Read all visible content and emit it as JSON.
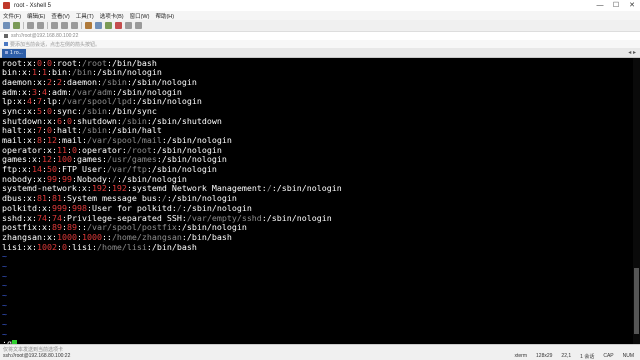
{
  "window": {
    "title": "root - Xshell 5",
    "controls": [
      "—",
      "☐",
      "✕"
    ]
  },
  "menu": [
    "文件(F)",
    "编辑(E)",
    "查看(V)",
    "工具(T)",
    "选项卡(B)",
    "窗口(W)",
    "帮助(H)"
  ],
  "address": {
    "text": "ssh://root@192.168.80.100:22"
  },
  "session_hint": {
    "text": "要添加当前会话，点击左侧的箭头按钮。"
  },
  "tabs": [
    {
      "label": "1 ro..."
    }
  ],
  "terminal": {
    "lines": [
      [
        {
          "t": "root",
          "c": "w"
        },
        {
          "t": ":x:",
          "c": "w"
        },
        {
          "t": "0",
          "c": "r"
        },
        {
          "t": ":",
          "c": "w"
        },
        {
          "t": "0",
          "c": "r"
        },
        {
          "t": ":root:",
          "c": "w"
        },
        {
          "t": "/root",
          "c": "d"
        },
        {
          "t": ":/bin/bash",
          "c": "w"
        }
      ],
      [
        {
          "t": "bin",
          "c": "w"
        },
        {
          "t": ":x:",
          "c": "w"
        },
        {
          "t": "1",
          "c": "r"
        },
        {
          "t": ":",
          "c": "w"
        },
        {
          "t": "1",
          "c": "r"
        },
        {
          "t": ":bin:",
          "c": "w"
        },
        {
          "t": "/bin",
          "c": "d"
        },
        {
          "t": ":/sbin/nologin",
          "c": "w"
        }
      ],
      [
        {
          "t": "daemon",
          "c": "w"
        },
        {
          "t": ":x:",
          "c": "w"
        },
        {
          "t": "2",
          "c": "r"
        },
        {
          "t": ":",
          "c": "w"
        },
        {
          "t": "2",
          "c": "r"
        },
        {
          "t": ":daemon:",
          "c": "w"
        },
        {
          "t": "/sbin",
          "c": "d"
        },
        {
          "t": ":/sbin/nologin",
          "c": "w"
        }
      ],
      [
        {
          "t": "adm",
          "c": "w"
        },
        {
          "t": ":x:",
          "c": "w"
        },
        {
          "t": "3",
          "c": "r"
        },
        {
          "t": ":",
          "c": "w"
        },
        {
          "t": "4",
          "c": "r"
        },
        {
          "t": ":adm:",
          "c": "w"
        },
        {
          "t": "/var/adm",
          "c": "d"
        },
        {
          "t": ":/sbin/nologin",
          "c": "w"
        }
      ],
      [
        {
          "t": "lp",
          "c": "w"
        },
        {
          "t": ":x:",
          "c": "w"
        },
        {
          "t": "4",
          "c": "r"
        },
        {
          "t": ":",
          "c": "w"
        },
        {
          "t": "7",
          "c": "r"
        },
        {
          "t": ":lp:",
          "c": "w"
        },
        {
          "t": "/var/spool/lpd",
          "c": "d"
        },
        {
          "t": ":/sbin/nologin",
          "c": "w"
        }
      ],
      [
        {
          "t": "sync",
          "c": "w"
        },
        {
          "t": ":x:",
          "c": "w"
        },
        {
          "t": "5",
          "c": "r"
        },
        {
          "t": ":",
          "c": "w"
        },
        {
          "t": "0",
          "c": "r"
        },
        {
          "t": ":sync:",
          "c": "w"
        },
        {
          "t": "/sbin",
          "c": "d"
        },
        {
          "t": ":/bin/sync",
          "c": "w"
        }
      ],
      [
        {
          "t": "shutdown",
          "c": "w"
        },
        {
          "t": ":x:",
          "c": "w"
        },
        {
          "t": "6",
          "c": "r"
        },
        {
          "t": ":",
          "c": "w"
        },
        {
          "t": "0",
          "c": "r"
        },
        {
          "t": ":shutdown:",
          "c": "w"
        },
        {
          "t": "/sbin",
          "c": "d"
        },
        {
          "t": ":/sbin/shutdown",
          "c": "w"
        }
      ],
      [
        {
          "t": "halt",
          "c": "w"
        },
        {
          "t": ":x:",
          "c": "w"
        },
        {
          "t": "7",
          "c": "r"
        },
        {
          "t": ":",
          "c": "w"
        },
        {
          "t": "0",
          "c": "r"
        },
        {
          "t": ":halt:",
          "c": "w"
        },
        {
          "t": "/sbin",
          "c": "d"
        },
        {
          "t": ":/sbin/halt",
          "c": "w"
        }
      ],
      [
        {
          "t": "mail",
          "c": "w"
        },
        {
          "t": ":x:",
          "c": "w"
        },
        {
          "t": "8",
          "c": "r"
        },
        {
          "t": ":",
          "c": "w"
        },
        {
          "t": "12",
          "c": "r"
        },
        {
          "t": ":mail:",
          "c": "w"
        },
        {
          "t": "/var/spool/mail",
          "c": "d"
        },
        {
          "t": ":/sbin/nologin",
          "c": "w"
        }
      ],
      [
        {
          "t": "operator",
          "c": "w"
        },
        {
          "t": ":x:",
          "c": "w"
        },
        {
          "t": "11",
          "c": "r"
        },
        {
          "t": ":",
          "c": "w"
        },
        {
          "t": "0",
          "c": "r"
        },
        {
          "t": ":operator:",
          "c": "w"
        },
        {
          "t": "/root",
          "c": "d"
        },
        {
          "t": ":/sbin/nologin",
          "c": "w"
        }
      ],
      [
        {
          "t": "games",
          "c": "w"
        },
        {
          "t": ":x:",
          "c": "w"
        },
        {
          "t": "12",
          "c": "r"
        },
        {
          "t": ":",
          "c": "w"
        },
        {
          "t": "100",
          "c": "r"
        },
        {
          "t": ":games:",
          "c": "w"
        },
        {
          "t": "/usr/games",
          "c": "d"
        },
        {
          "t": ":/sbin/nologin",
          "c": "w"
        }
      ],
      [
        {
          "t": "ftp",
          "c": "w"
        },
        {
          "t": ":x:",
          "c": "w"
        },
        {
          "t": "14",
          "c": "r"
        },
        {
          "t": ":",
          "c": "w"
        },
        {
          "t": "50",
          "c": "r"
        },
        {
          "t": ":FTP User:",
          "c": "w"
        },
        {
          "t": "/var/ftp",
          "c": "d"
        },
        {
          "t": ":/sbin/nologin",
          "c": "w"
        }
      ],
      [
        {
          "t": "nobody",
          "c": "w"
        },
        {
          "t": ":x:",
          "c": "w"
        },
        {
          "t": "99",
          "c": "r"
        },
        {
          "t": ":",
          "c": "w"
        },
        {
          "t": "99",
          "c": "r"
        },
        {
          "t": ":Nobody:",
          "c": "w"
        },
        {
          "t": "/",
          "c": "d"
        },
        {
          "t": ":/sbin/nologin",
          "c": "w"
        }
      ],
      [
        {
          "t": "systemd-network",
          "c": "w"
        },
        {
          "t": ":x:",
          "c": "w"
        },
        {
          "t": "192",
          "c": "r"
        },
        {
          "t": ":",
          "c": "w"
        },
        {
          "t": "192",
          "c": "r"
        },
        {
          "t": ":systemd Network Management:",
          "c": "w"
        },
        {
          "t": "/",
          "c": "d"
        },
        {
          "t": ":/sbin/nologin",
          "c": "w"
        }
      ],
      [
        {
          "t": "dbus",
          "c": "w"
        },
        {
          "t": ":x:",
          "c": "w"
        },
        {
          "t": "81",
          "c": "r"
        },
        {
          "t": ":",
          "c": "w"
        },
        {
          "t": "81",
          "c": "r"
        },
        {
          "t": ":System message bus:",
          "c": "w"
        },
        {
          "t": "/",
          "c": "d"
        },
        {
          "t": ":/sbin/nologin",
          "c": "w"
        }
      ],
      [
        {
          "t": "polkitd",
          "c": "w"
        },
        {
          "t": ":x:",
          "c": "w"
        },
        {
          "t": "999",
          "c": "r"
        },
        {
          "t": ":",
          "c": "w"
        },
        {
          "t": "998",
          "c": "r"
        },
        {
          "t": ":User for polkitd:",
          "c": "w"
        },
        {
          "t": "/",
          "c": "d"
        },
        {
          "t": ":/sbin/nologin",
          "c": "w"
        }
      ],
      [
        {
          "t": "sshd",
          "c": "w"
        },
        {
          "t": ":x:",
          "c": "w"
        },
        {
          "t": "74",
          "c": "r"
        },
        {
          "t": ":",
          "c": "w"
        },
        {
          "t": "74",
          "c": "r"
        },
        {
          "t": ":Privilege-separated SSH:",
          "c": "w"
        },
        {
          "t": "/var/empty/sshd",
          "c": "d"
        },
        {
          "t": ":/sbin/nologin",
          "c": "w"
        }
      ],
      [
        {
          "t": "postfix",
          "c": "w"
        },
        {
          "t": ":x:",
          "c": "w"
        },
        {
          "t": "89",
          "c": "r"
        },
        {
          "t": ":",
          "c": "w"
        },
        {
          "t": "89",
          "c": "r"
        },
        {
          "t": "::",
          "c": "w"
        },
        {
          "t": "/var/spool/postfix",
          "c": "d"
        },
        {
          "t": ":/sbin/nologin",
          "c": "w"
        }
      ],
      [
        {
          "t": "zhangsan",
          "c": "w"
        },
        {
          "t": ":x:",
          "c": "w"
        },
        {
          "t": "1000",
          "c": "r"
        },
        {
          "t": ":",
          "c": "w"
        },
        {
          "t": "1000",
          "c": "r"
        },
        {
          "t": "::",
          "c": "w"
        },
        {
          "t": "/home/zhangsan",
          "c": "d"
        },
        {
          "t": ":/bin/bash",
          "c": "w"
        }
      ],
      [
        {
          "t": "lisi",
          "c": "w"
        },
        {
          "t": ":x:",
          "c": "w"
        },
        {
          "t": "1002",
          "c": "r"
        },
        {
          "t": ":",
          "c": "w"
        },
        {
          "t": "0",
          "c": "r"
        },
        {
          "t": ":lisi:",
          "c": "w"
        },
        {
          "t": "/home/lisi",
          "c": "d"
        },
        {
          "t": ":/bin/bash",
          "c": "w"
        }
      ]
    ],
    "tilde_count": 9,
    "tilde_char": "~",
    "command_prompt": ":q",
    "colors": {
      "w": "#ffffff",
      "r": "#e03a3a",
      "d": "#8e8e8e",
      "tilde": "#3b5bd8",
      "cursor": "#2fd02f"
    }
  },
  "status": {
    "send_hint": "仅将文本发送到当前选项卡",
    "connection": "ssh://root@192.168.80.100:22",
    "items": [
      "xterm",
      "128x29",
      "22,1",
      "1 会话",
      "CAP",
      "NUM"
    ]
  }
}
